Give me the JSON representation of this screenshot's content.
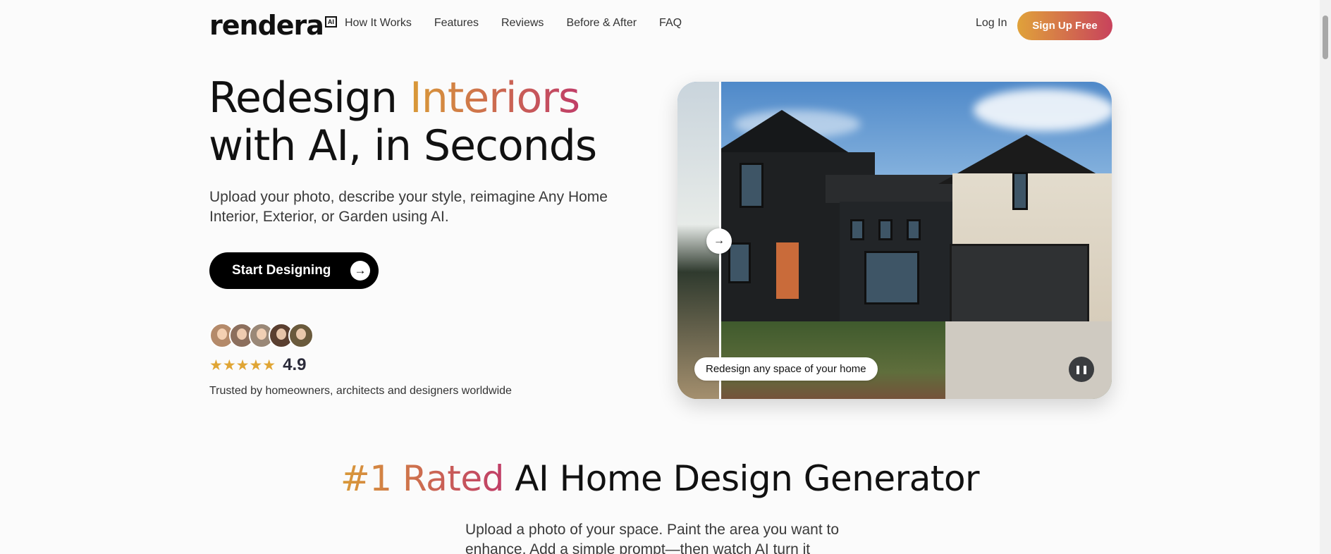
{
  "nav": {
    "logo_text": "rendera",
    "logo_badge": "AI",
    "links": [
      "How It Works",
      "Features",
      "Reviews",
      "Before & After",
      "FAQ"
    ],
    "login": "Log In",
    "signup": "Sign Up Free"
  },
  "hero": {
    "title_part1": "Redesign ",
    "title_highlight": "Interiors",
    "title_part2": "with AI, in Seconds",
    "subtitle": "Upload your photo, describe your style, reimagine Any Home Interior, Exterior, or Garden using AI.",
    "cta": "Start Designing",
    "stars": "★★★★★",
    "rating": "4.9",
    "trusted": "Trusted by homeowners, architects and designers worldwide",
    "avatar_colors": [
      "#b48a6a",
      "#8c6f5d",
      "#9a8877",
      "#5a3f30",
      "#6a5a3c"
    ]
  },
  "showcase": {
    "caption": "Redesign any space of your home",
    "pause_icon": "pause-icon",
    "slider_icon": "arrow-right-icon"
  },
  "section": {
    "title_highlight": "#1 Rated",
    "title_rest": " AI Home Design Generator",
    "subtitle": "Upload a photo of your space. Paint the area you want to enhance. Add a simple prompt—then watch AI turn it"
  },
  "colors": {
    "accent_start": "#e0a23a",
    "accent_end": "#c8425c",
    "cta_bg": "#000000",
    "star": "#e0a534"
  }
}
